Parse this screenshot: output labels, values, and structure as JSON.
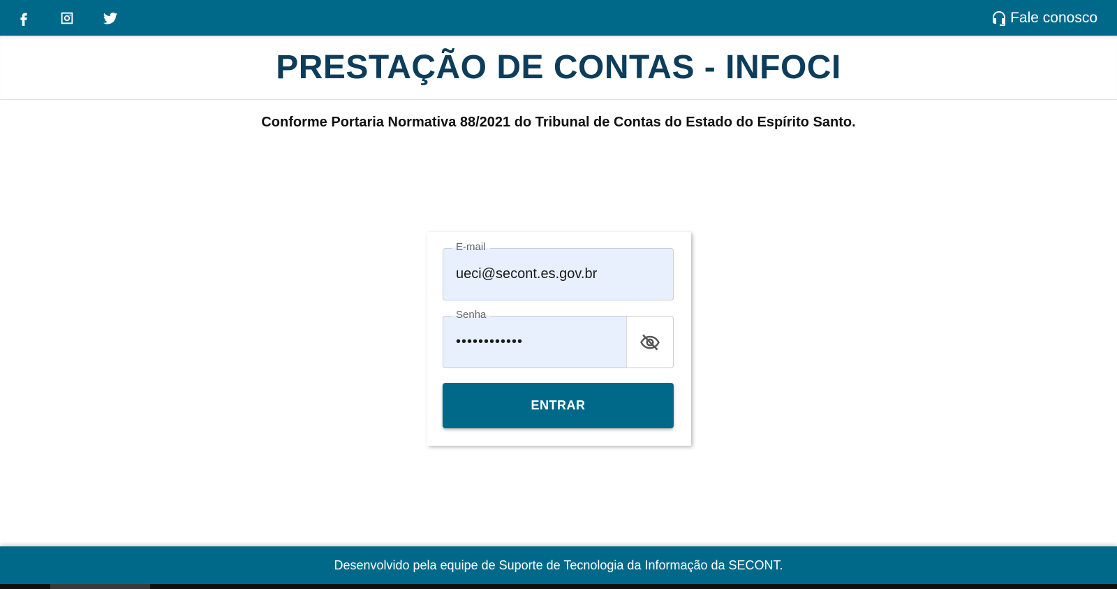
{
  "topbar": {
    "social": [
      {
        "name": "facebook-icon"
      },
      {
        "name": "instagram-icon"
      },
      {
        "name": "twitter-icon"
      }
    ],
    "contact_label": "Fale conosco",
    "contact_icon": "headset-icon",
    "background": "#00698a"
  },
  "header": {
    "title": "PRESTAÇÃO DE CONTAS - INFOCI",
    "subtitle": "Conforme Portaria Normativa 88/2021 do Tribunal de Contas do Estado do Espírito Santo."
  },
  "login": {
    "email_label": "E-mail",
    "email_value": "ueci@secont.es.gov.br",
    "password_label": "Senha",
    "password_value": "••••••••••••",
    "toggle_icon": "eye-off-icon",
    "submit_label": "ENTRAR"
  },
  "footer": {
    "text": "Desenvolvido pela equipe de Suporte de Tecnologia da Informação da SECONT."
  },
  "colors": {
    "primary": "#00698a",
    "title": "#0d3d5a",
    "field_bg": "#e8f0fe"
  }
}
